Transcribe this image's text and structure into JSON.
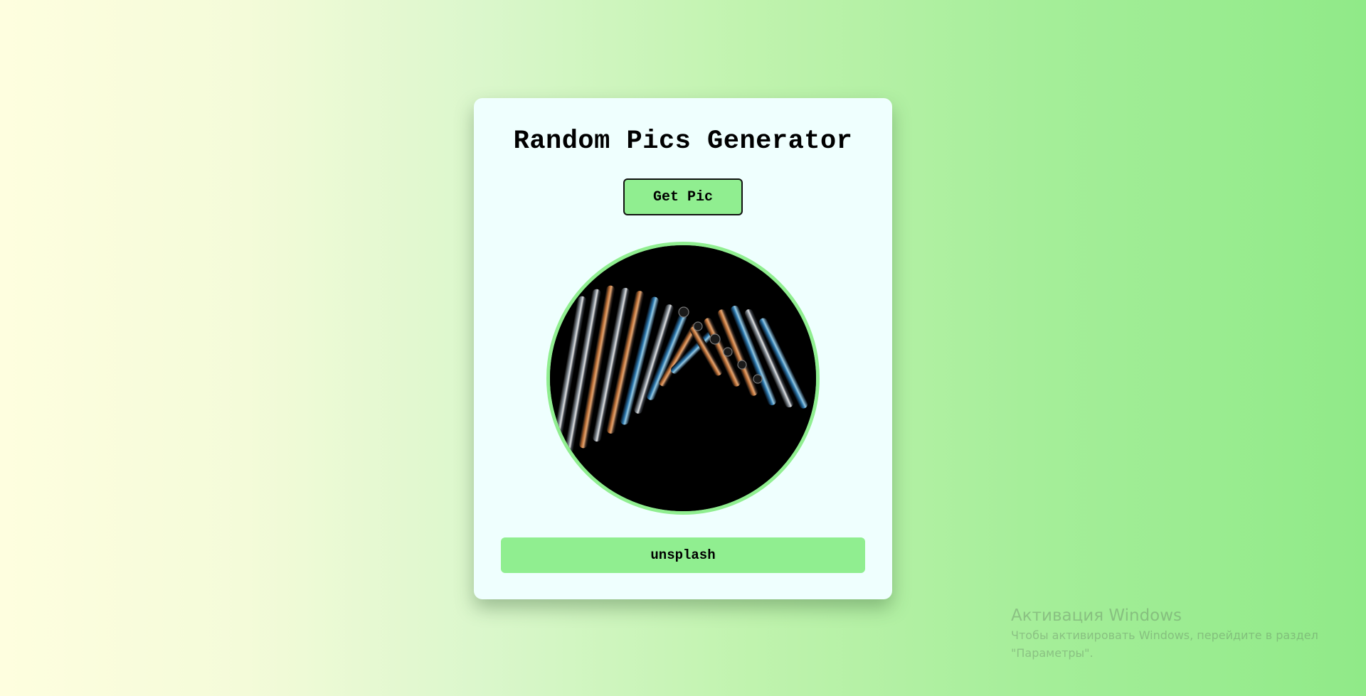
{
  "app": {
    "title": "Random Pics Generator",
    "get_button_label": "Get Pic",
    "image_alt": "random picture",
    "source_label": "unsplash"
  },
  "colors": {
    "accent": "#90ee90",
    "card": "#effffe",
    "background_start": "#fefedf",
    "background_end": "#90ea88"
  },
  "os_watermark": {
    "title": "Активация Windows",
    "line1": "Чтобы активировать Windows, перейдите в раздел",
    "line2": "\"Параметры\"."
  }
}
